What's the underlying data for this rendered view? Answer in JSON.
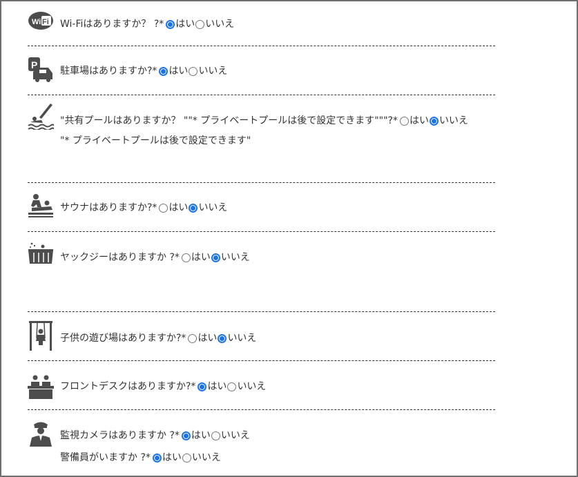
{
  "questions": [
    {
      "id": "wifi",
      "icon": "wifi-icon",
      "label": "Wi-Fiはありますか？ ?*",
      "yes": "はい",
      "no": "いいえ",
      "selected": "yes"
    },
    {
      "id": "parking",
      "icon": "parking-icon",
      "label": "駐車場はありますか?*",
      "yes": "はい",
      "no": "いいえ",
      "selected": "yes"
    },
    {
      "id": "pool",
      "icon": "pool-icon",
      "label": "\"共有プールはありますか？ \"\"* プライベートプールは後で設定できます\"\"\"?*",
      "yes": "はい",
      "no": "いいえ",
      "selected": "no",
      "note": "\"* プライベートプールは後で設定できます\""
    },
    {
      "id": "sauna",
      "icon": "sauna-icon",
      "label": "サウナはありますか?*",
      "yes": "はい",
      "no": "いいえ",
      "selected": "no"
    },
    {
      "id": "jacuzzi",
      "icon": "jacuzzi-icon",
      "label": "ヤックジーはありますか ?*",
      "yes": "はい",
      "no": "いいえ",
      "selected": "no"
    },
    {
      "id": "playground",
      "icon": "playground-icon",
      "label": "子供の遊び場はありますか?*",
      "yes": "はい",
      "no": "いいえ",
      "selected": "no"
    },
    {
      "id": "frontdesk",
      "icon": "front-desk-icon",
      "label": "フロントデスクはありますか?*",
      "yes": "はい",
      "no": "いいえ",
      "selected": "yes"
    },
    {
      "id": "cctv",
      "icon": "security-guard-icon",
      "label": "監視カメラはありますか ?*",
      "yes": "はい",
      "no": "いいえ",
      "selected": "yes"
    },
    {
      "id": "guard",
      "label": "警備員がいますか ?*",
      "yes": "はい",
      "no": "いいえ",
      "selected": "yes"
    }
  ],
  "colors": {
    "accent": "#1a73e8",
    "icon": "#4d4d4d",
    "divider": "#333333"
  }
}
